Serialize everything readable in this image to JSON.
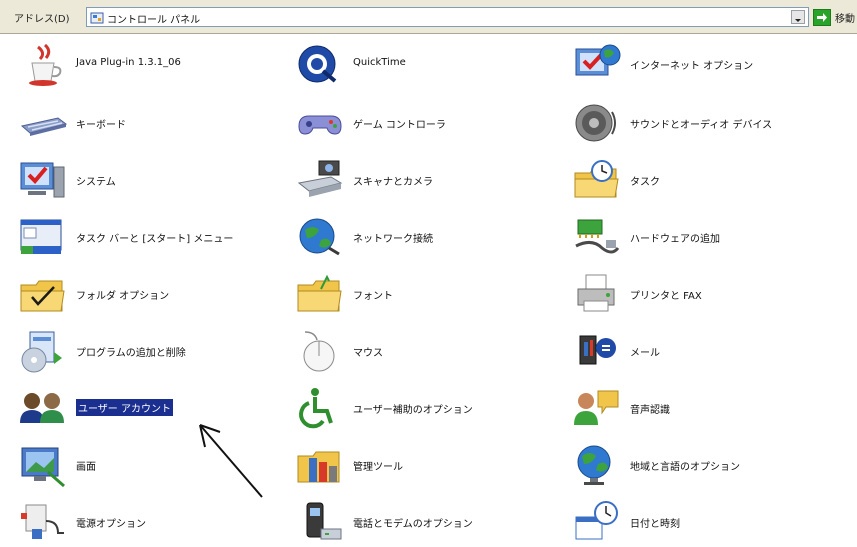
{
  "address_bar": {
    "label": "アドレス(D)",
    "value": "コントロール パネル",
    "go_label": "移動"
  },
  "columns": [
    {
      "items": [
        {
          "label": "Java Plug-in 1.3.1_06",
          "icon": "java-cup-icon"
        },
        {
          "label": "キーボード",
          "icon": "keyboard-icon"
        },
        {
          "label": "システム",
          "icon": "system-icon"
        },
        {
          "label": "タスク バーと [スタート] メニュー",
          "icon": "taskbar-icon"
        },
        {
          "label": "フォルダ オプション",
          "icon": "folder-options-icon"
        },
        {
          "label": "プログラムの追加と削除",
          "icon": "add-remove-programs-icon"
        },
        {
          "label": "ユーザー アカウント",
          "icon": "user-accounts-icon",
          "selected": true
        },
        {
          "label": "画面",
          "icon": "display-icon"
        },
        {
          "label": "電源オプション",
          "icon": "power-options-icon"
        }
      ]
    },
    {
      "items": [
        {
          "label": "QuickTime",
          "icon": "quicktime-icon"
        },
        {
          "label": "ゲーム コントローラ",
          "icon": "game-controller-icon"
        },
        {
          "label": "スキャナとカメラ",
          "icon": "scanner-camera-icon"
        },
        {
          "label": "ネットワーク接続",
          "icon": "network-icon"
        },
        {
          "label": "フォント",
          "icon": "fonts-folder-icon"
        },
        {
          "label": "マウス",
          "icon": "mouse-icon"
        },
        {
          "label": "ユーザー補助のオプション",
          "icon": "accessibility-icon"
        },
        {
          "label": "管理ツール",
          "icon": "admin-tools-icon"
        },
        {
          "label": "電話とモデムのオプション",
          "icon": "phone-modem-icon"
        }
      ]
    },
    {
      "items": [
        {
          "label": "インターネット オプション",
          "icon": "internet-options-icon"
        },
        {
          "label": "サウンドとオーディオ デバイス",
          "icon": "speaker-icon"
        },
        {
          "label": "タスク",
          "icon": "scheduled-tasks-icon"
        },
        {
          "label": "ハードウェアの追加",
          "icon": "add-hardware-icon"
        },
        {
          "label": "プリンタと FAX",
          "icon": "printer-icon"
        },
        {
          "label": "メール",
          "icon": "mail-icon"
        },
        {
          "label": "音声認識",
          "icon": "speech-icon"
        },
        {
          "label": "地域と言語のオプション",
          "icon": "globe-icon"
        },
        {
          "label": "日付と時刻",
          "icon": "date-time-icon"
        }
      ]
    }
  ]
}
